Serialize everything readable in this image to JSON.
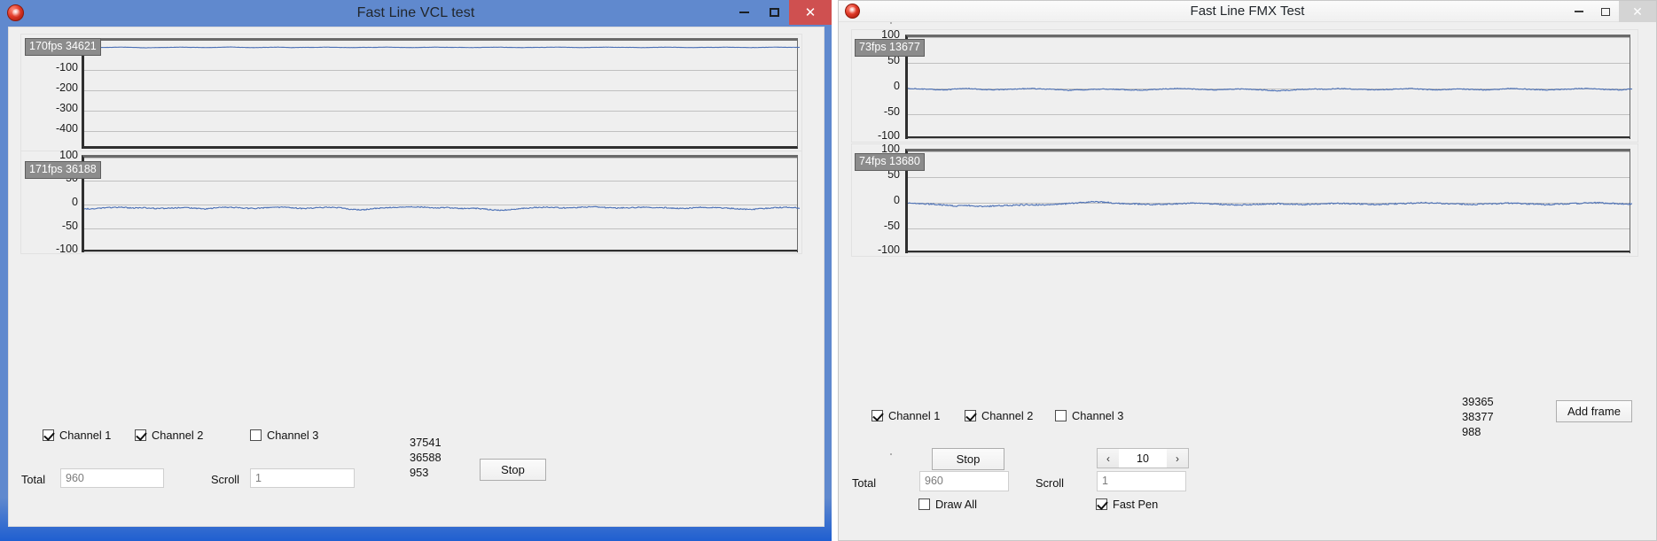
{
  "vcl_window": {
    "title": "Fast Line VCL test",
    "app_icon": "delphi-app-icon",
    "window_buttons": {
      "minimize": "–",
      "maximize": "☐",
      "close": "✕"
    },
    "charts": [
      {
        "fps_badge": "170fps 34621",
        "yticks": [
          "-100",
          "-200",
          "-300",
          "-400"
        ],
        "ytick_values": [
          -100,
          -200,
          -300,
          -400
        ],
        "line_color": "#4a6fb5",
        "baseline_ratio": 0.06
      },
      {
        "fps_badge": "171fps 36188",
        "yticks": [
          "100",
          "50",
          "0",
          "-50",
          "-100"
        ],
        "ytick_values": [
          100,
          50,
          0,
          -50,
          -100
        ],
        "line_color": "#4a6fb5",
        "baseline_ratio": 0.52
      }
    ],
    "channels": [
      {
        "label": "Channel 1",
        "checked": true
      },
      {
        "label": "Channel 2",
        "checked": true
      },
      {
        "label": "Channel 3",
        "checked": false
      }
    ],
    "stats": [
      "37541",
      "36588",
      "953"
    ],
    "stop_button": "Stop",
    "total_label": "Total",
    "total_value": "960",
    "scroll_label": "Scroll",
    "scroll_value": "1"
  },
  "fmx_window": {
    "title": "Fast Line FMX Test",
    "app_icon": "delphi-app-icon",
    "window_buttons": {
      "minimize": "–",
      "maximize": "☐",
      "close": "✕"
    },
    "charts": [
      {
        "fps_badge": "73fps 13677",
        "yticks": [
          "100",
          "50",
          "0",
          "-50",
          "-100"
        ],
        "ytick_values": [
          100,
          50,
          0,
          -50,
          -100
        ],
        "line_color": "#4a6fb5",
        "baseline_ratio": 0.5
      },
      {
        "fps_badge": "74fps 13680",
        "yticks": [
          "100",
          "50",
          "0",
          "-50",
          "-100"
        ],
        "ytick_values": [
          100,
          50,
          0,
          -50,
          -100
        ],
        "line_color": "#4a6fb5",
        "baseline_ratio": 0.5
      }
    ],
    "channels": [
      {
        "label": "Channel 1",
        "checked": true
      },
      {
        "label": "Channel 2",
        "checked": true
      },
      {
        "label": "Channel 3",
        "checked": false
      }
    ],
    "stats": [
      "39365",
      "38377",
      "988"
    ],
    "add_frame_button": "Add frame",
    "stop_button": "Stop",
    "total_label": "Total",
    "total_value": "960",
    "scroll_label": "Scroll",
    "scroll_value": "1",
    "stepper": {
      "value": "10",
      "prev": "‹",
      "next": "›"
    },
    "draw_all": {
      "label": "Draw All",
      "checked": false
    },
    "fast_pen": {
      "label": "Fast Pen",
      "checked": true
    }
  },
  "chart_data": [
    {
      "type": "line",
      "title": "170fps 34621",
      "xlabel": "",
      "ylabel": "",
      "ylim": [
        -450,
        60
      ],
      "yticks": [
        -100,
        -200,
        -300,
        -400
      ],
      "grid": true,
      "legend": "none",
      "series": [
        {
          "name": "Channel 1",
          "color": "#4a6fb5",
          "mean": 0,
          "amplitude": 3,
          "values": [
            0,
            -1,
            0,
            1,
            0,
            -2,
            -1,
            0,
            1,
            0,
            -1,
            0,
            2,
            0,
            -1,
            0,
            1,
            -1,
            0,
            0,
            1,
            0,
            -1,
            0,
            0,
            1,
            0,
            -1,
            0,
            1,
            0,
            0,
            -1,
            0,
            1,
            0,
            -1,
            0,
            0,
            1,
            0,
            -1,
            0,
            1,
            0,
            0,
            -1,
            0,
            1,
            0,
            -1,
            0,
            0,
            1,
            0,
            -1,
            0,
            1,
            0,
            0
          ]
        }
      ]
    },
    {
      "type": "line",
      "title": "171fps 36188",
      "xlabel": "",
      "ylabel": "",
      "ylim": [
        -110,
        110
      ],
      "yticks": [
        100,
        50,
        0,
        -50,
        -100
      ],
      "grid": true,
      "legend": "none",
      "series": [
        {
          "name": "Channel 1",
          "color": "#4a6fb5",
          "mean": -4,
          "amplitude": 7,
          "values": [
            -6,
            -5,
            -3,
            -2,
            -4,
            -3,
            -5,
            -4,
            -3,
            -4,
            -6,
            -3,
            -2,
            -4,
            -5,
            -3,
            -2,
            -3,
            -5,
            -4,
            -2,
            -3,
            -7,
            -8,
            -5,
            -3,
            -2,
            -1,
            -2,
            -4,
            -3,
            -5,
            -4,
            -6,
            -9,
            -8,
            -5,
            -3,
            -2,
            -3,
            -4,
            -2,
            -1,
            -3,
            -4,
            -3,
            -2,
            -4,
            -3,
            -5,
            -4,
            -2,
            -3,
            -4,
            -6,
            -7,
            -5,
            -3,
            -2,
            -4
          ]
        }
      ]
    },
    {
      "type": "line",
      "title": "73fps 13677",
      "xlabel": "",
      "ylabel": "",
      "ylim": [
        -110,
        110
      ],
      "yticks": [
        100,
        50,
        0,
        -50,
        -100
      ],
      "grid": true,
      "legend": "none",
      "series": [
        {
          "name": "Channel 1",
          "color": "#4a6fb5",
          "mean": 0,
          "amplitude": 5,
          "values": [
            2,
            1,
            0,
            -1,
            1,
            2,
            0,
            -1,
            0,
            1,
            2,
            1,
            0,
            -2,
            -1,
            0,
            1,
            0,
            -1,
            -2,
            0,
            1,
            2,
            1,
            0,
            -1,
            0,
            1,
            0,
            -1,
            -3,
            -2,
            0,
            1,
            0,
            2,
            1,
            0,
            -1,
            0,
            1,
            2,
            0,
            -1,
            0,
            1,
            0,
            -1,
            0,
            2,
            1,
            0,
            -1,
            0,
            1,
            2,
            1,
            0,
            -1,
            1
          ]
        }
      ]
    },
    {
      "type": "line",
      "title": "74fps 13680",
      "xlabel": "",
      "ylabel": "",
      "ylim": [
        -110,
        110
      ],
      "yticks": [
        100,
        50,
        0,
        -50,
        -100
      ],
      "grid": true,
      "legend": "none",
      "series": [
        {
          "name": "Channel 1",
          "color": "#4a6fb5",
          "mean": -2,
          "amplitude": 8,
          "values": [
            1,
            0,
            -1,
            -3,
            -5,
            -4,
            -6,
            -5,
            -4,
            -3,
            -2,
            -3,
            -1,
            0,
            2,
            4,
            3,
            1,
            0,
            -1,
            -2,
            -1,
            0,
            1,
            0,
            -1,
            -2,
            -3,
            -2,
            -1,
            0,
            -1,
            -2,
            -1,
            0,
            1,
            0,
            -1,
            -2,
            -1,
            0,
            1,
            2,
            1,
            0,
            -1,
            -2,
            -1,
            0,
            1,
            0,
            -1,
            -2,
            -1,
            0,
            1,
            2,
            1,
            0,
            -1
          ]
        }
      ]
    }
  ]
}
